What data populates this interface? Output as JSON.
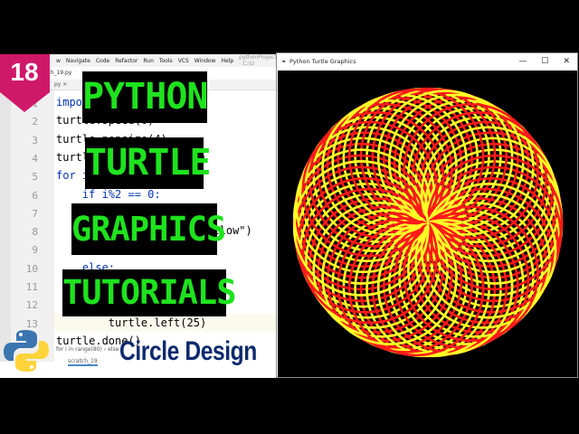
{
  "badge": {
    "number": "18",
    "color": "#d0186a"
  },
  "ide": {
    "menu": [
      "w",
      "Navigate",
      "Code",
      "Refactor",
      "Run",
      "Tools",
      "VCS",
      "Window",
      "Help"
    ],
    "project": "pythonProject - C:\\U",
    "file": "tch_19.py",
    "tab": "py ×",
    "lines": [
      {
        "n": "1",
        "t": "import turtle",
        "kw": true
      },
      {
        "n": "2",
        "t": "turtle.speed(0)"
      },
      {
        "n": "3",
        "t": "turtle.pensize(4)"
      },
      {
        "n": "4",
        "t": "turtle.bgcolor(\"black\")"
      },
      {
        "n": "5",
        "t": "for i in range(80):",
        "kw": true
      },
      {
        "n": "6",
        "t": "    if i%2 == 0:",
        "kw": true
      },
      {
        "n": "7",
        "t": ""
      },
      {
        "n": "8",
        "t": "        turtle.color(\"yellow\")"
      },
      {
        "n": "9",
        "t": ""
      },
      {
        "n": "10",
        "t": "    else:",
        "kw": true
      },
      {
        "n": "11",
        "t": ""
      },
      {
        "n": "12",
        "t": ""
      },
      {
        "n": "13",
        "t": "        turtle.left(25)"
      },
      {
        "n": "",
        "t": "turtle.done()"
      }
    ],
    "breadcrumb": "for i in range(80)  ›  else",
    "bottom_tab": "scratch_19"
  },
  "turtle_window": {
    "title": "Python Turtle Graphics",
    "minimize": "—",
    "maximize": "☐",
    "close": "✕",
    "colors": [
      "#ff1a1a",
      "#ffff26"
    ],
    "circles": 80
  },
  "overlay": {
    "line1": "PYTHON",
    "line2": "TURTLE",
    "line3": "GRAPHICS",
    "line4": "TUTORIALS",
    "subtitle": "Circle Design"
  }
}
